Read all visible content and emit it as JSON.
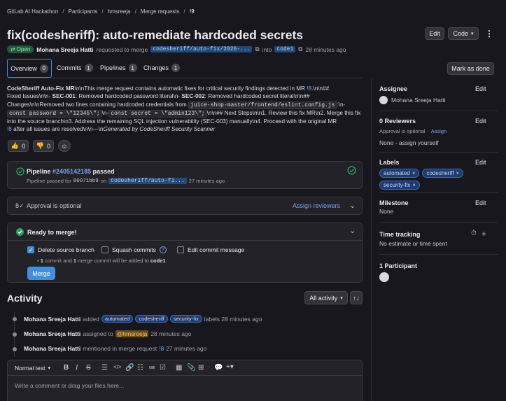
{
  "breadcrumb": [
    "GitLab AI Hackathon",
    "Participants",
    "hmsreeja",
    "Merge requests",
    "!9"
  ],
  "title": "fix(codesheriff): auto-remediate hardcoded secrets",
  "header_buttons": {
    "edit": "Edit",
    "code": "Code"
  },
  "status": {
    "state": "Open",
    "author": "Mohana Sreeja Hatti",
    "requested_text": "requested to merge",
    "source_branch": "codesheriff/auto-fix/2026-...",
    "into_text": "into",
    "target_branch": "code1",
    "time": "28 minutes ago"
  },
  "tabs": [
    {
      "label": "Overview",
      "count": "0"
    },
    {
      "label": "Commits",
      "count": "1"
    },
    {
      "label": "Pipelines",
      "count": "1"
    },
    {
      "label": "Changes",
      "count": "1"
    }
  ],
  "mark_done": "Mark as done",
  "description": {
    "l1_bold": "CodeSheriff Auto-Fix MR",
    "l1_rest": "\\n\\nThis merge request contains automatic fixes for critical security findings detected in MR ",
    "l1_link": "!8",
    "l1_end": ".\\n\\n##",
    "l2_a": "Fixed Issues\\n\\n- ",
    "l2_b1": "SEC-001",
    "l2_c": ": Removed hardcoded password literal\\n- ",
    "l2_b2": "SEC-002",
    "l2_d": ": Removed hardcoded secret literal\\n\\n##",
    "l3_a": "Changes\\n\\nRemoved two lines containing hardcoded credentials from ",
    "l3_code": "juice-shop-master/frontend/eslint.config.js",
    "l3_b": ":\\n-",
    "l4_code1": "const password = \\\"12345\\\";",
    "l4_a": "\\n-",
    "l4_code2": "const secret = \\\"admin123\\\";",
    "l4_b": "\\n\\n## Next Steps\\n\\n1. Review this fix MR\\n2. Merge this fix",
    "l5": "into the source branch\\n3. Address the remaining SQL injection vulnerability (SEC-003) manually\\n4. Proceed with the original MR",
    "l6_link": "!8",
    "l6_a": " after all issues are resolved\\n\\n---\\n",
    "l6_em": "Generated by CodeSheriff Security Scanner"
  },
  "reactions": {
    "thumbs_up": "0",
    "thumbs_down": "0"
  },
  "pipeline": {
    "label": "Pipeline",
    "id": "#2405142185",
    "state": "passed",
    "sub_a": "Pipeline passed for",
    "commit": "80071bb9",
    "on": "on",
    "branch": "codesheriff/auto-fi...",
    "time": "27 minutes ago"
  },
  "approval": {
    "text": "Approval is optional",
    "assign": "Assign reviewers"
  },
  "merge": {
    "title": "Ready to merge!",
    "delete_branch": "Delete source branch",
    "squash": "Squash commits",
    "edit_msg": "Edit commit message",
    "info_a": "• ",
    "info_b1": "1",
    "info_c": " commit and ",
    "info_b2": "1",
    "info_d": " merge commit will be added to ",
    "info_b3": "code1",
    "info_e": ".",
    "button": "Merge"
  },
  "activity": {
    "title": "Activity",
    "filter": "All activity",
    "items": [
      {
        "author": "Mohana Sreeja Hatti",
        "verb": "added",
        "labels": [
          "automated",
          "codesheriff",
          "security-fix"
        ],
        "tail": "labels 28 minutes ago"
      },
      {
        "author": "Mohana Sreeja Hatti",
        "verb": "assigned to",
        "mention": "@hmsreeja",
        "tail": "28 minutes ago"
      },
      {
        "author": "Mohana Sreeja Hatti",
        "verb": "mentioned in merge request",
        "link": "!8",
        "tail": "27 minutes ago"
      }
    ]
  },
  "editor": {
    "format": "Normal text",
    "placeholder": "Write a comment or drag your files here..."
  },
  "sidebar": {
    "assignee": {
      "title": "Assignee",
      "edit": "Edit",
      "name": "Mohana Sreeja Hatti"
    },
    "reviewers": {
      "title": "0 Reviewers",
      "edit": "Edit",
      "optional": "Approval is optional",
      "assign": "Assign",
      "none": "None - assign yourself"
    },
    "labels": {
      "title": "Labels",
      "edit": "Edit",
      "items": [
        "automated",
        "codesheriff",
        "security-fix"
      ]
    },
    "milestone": {
      "title": "Milestone",
      "edit": "Edit",
      "value": "None"
    },
    "time_tracking": {
      "title": "Time tracking",
      "value": "No estimate or time spent"
    },
    "participants": {
      "title": "1 Participant"
    }
  },
  "colors": {
    "accent": "#428fdc",
    "success": "#2da160",
    "background": "#18171d",
    "panel": "#232228"
  }
}
